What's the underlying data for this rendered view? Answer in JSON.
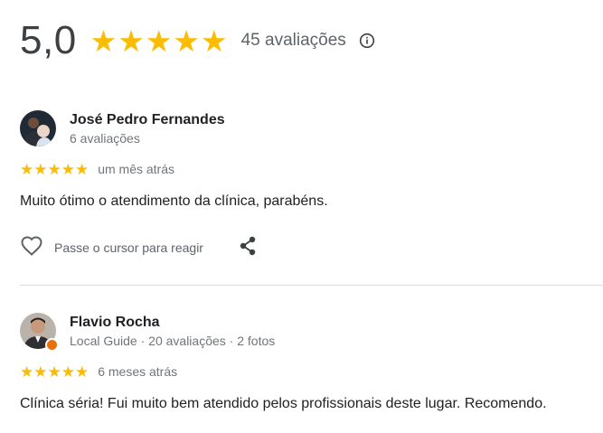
{
  "summary": {
    "rating": "5,0",
    "stars": "★★★★★",
    "count": "45 avaliações"
  },
  "reviews": [
    {
      "name": "José Pedro Fernandes",
      "sub": "6 avaliações",
      "stars": "★★★★★",
      "date": "um mês atrás",
      "text": "Muito ótimo o atendimento da clínica, parabéns.",
      "react_label": "Passe o cursor para reagir"
    },
    {
      "name": "Flavio Rocha",
      "sub": "Local Guide · 20 avaliações · 2 fotos",
      "stars": "★★★★★",
      "date": "6 meses atrás",
      "text": "Clínica séria! Fui muito bem atendido pelos profissionais deste lugar. Recomendo."
    }
  ],
  "colors": {
    "star": "#fbbc04",
    "local_guide_badge": "#e8710a"
  }
}
